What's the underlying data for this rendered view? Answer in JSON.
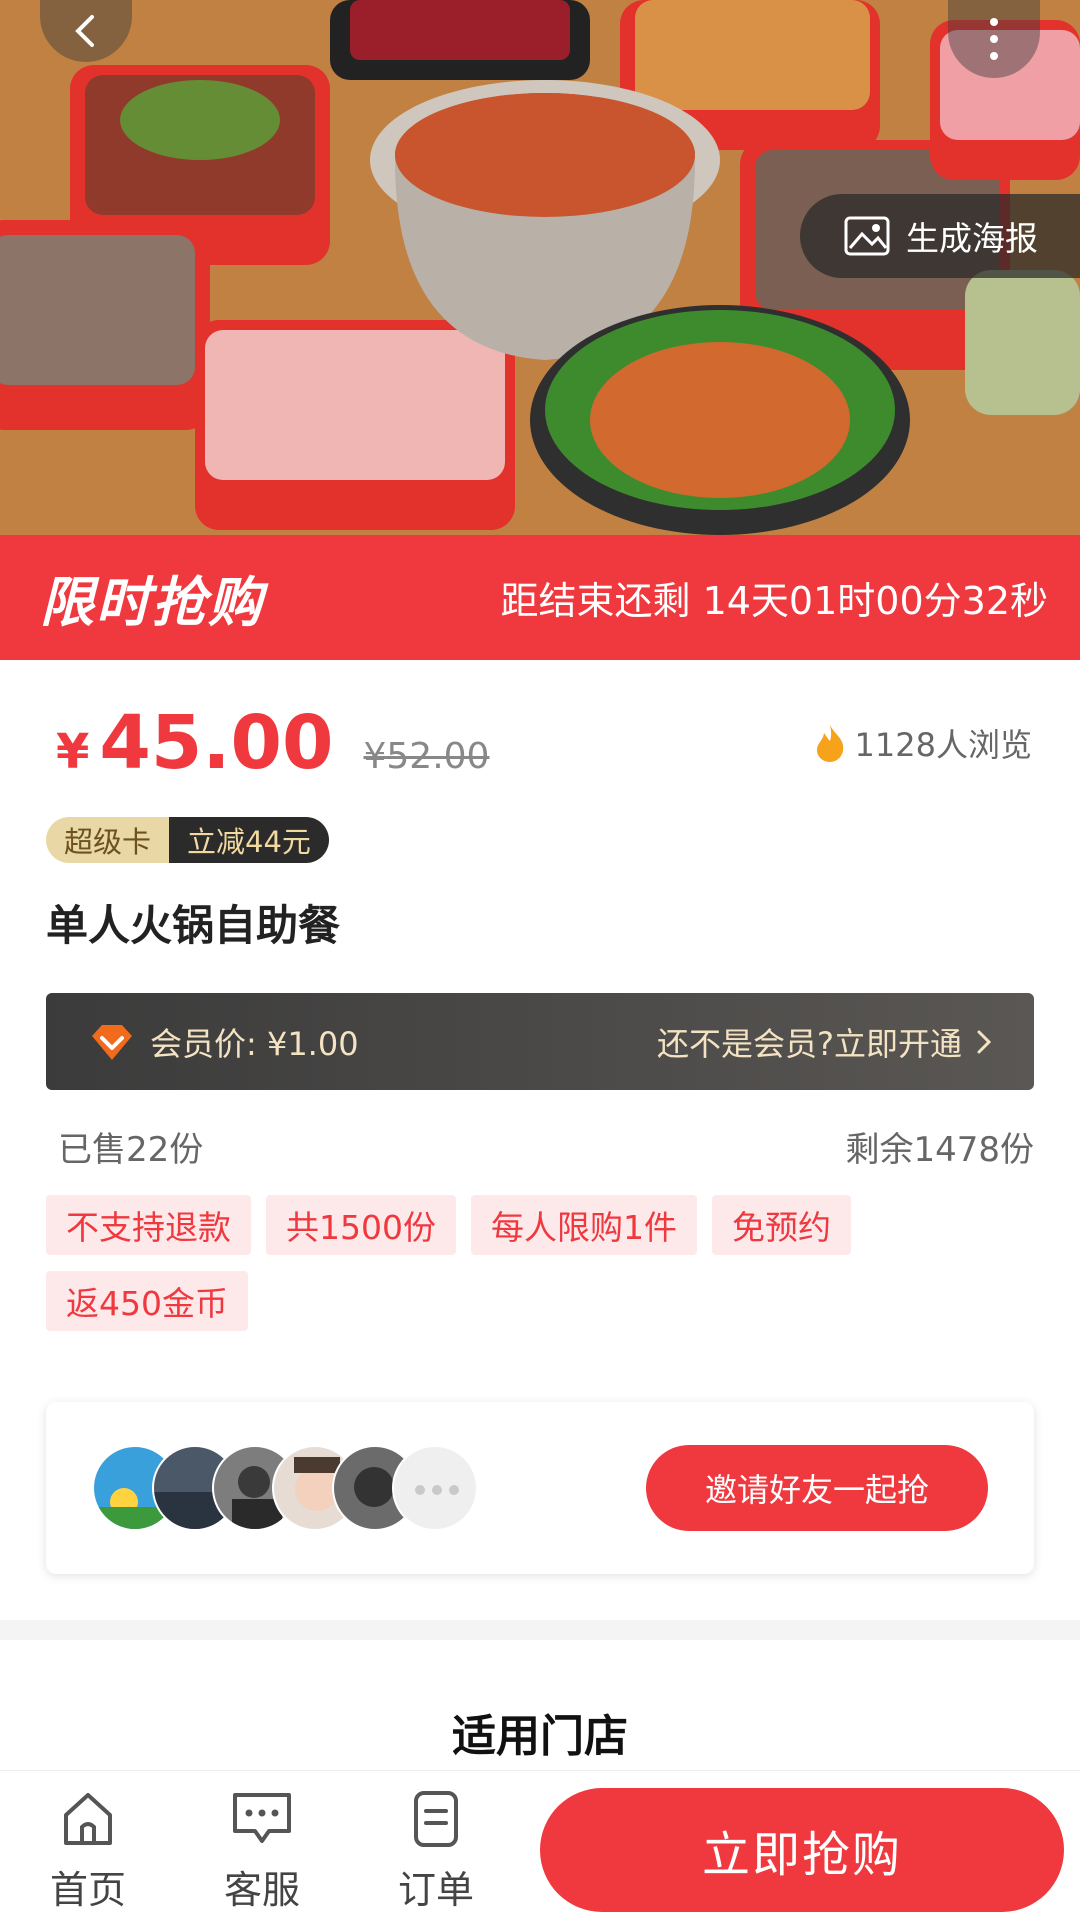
{
  "hero": {
    "poster_label": "生成海报"
  },
  "flash_sale": {
    "title": "限时抢购",
    "countdown": "距结束还剩 14天01时00分32秒"
  },
  "price": {
    "currency_symbol": "¥",
    "current": "45.00",
    "original": "¥52.00",
    "views": "1128人浏览"
  },
  "badge": {
    "card_label": "超级卡",
    "discount_label": "立减44元"
  },
  "product": {
    "title": "单人火锅自助餐"
  },
  "member": {
    "price_label": "会员价:  ¥1.00",
    "cta_label": "还不是会员?立即开通"
  },
  "stock": {
    "sold": "已售22份",
    "remaining": "剩余1478份"
  },
  "tags": [
    "不支持退款",
    "共1500份",
    "每人限购1件",
    "免预约",
    "返450金币"
  ],
  "invite": {
    "button_label": "邀请好友一起抢"
  },
  "stores": {
    "title": "适用门店"
  },
  "bottom_nav": {
    "home": "首页",
    "service": "客服",
    "orders": "订单",
    "buy_label": "立即抢购"
  },
  "colors": {
    "accent": "#f0383f",
    "member_bar": "#3b3b3b",
    "tag_bg": "#fde9ea"
  }
}
